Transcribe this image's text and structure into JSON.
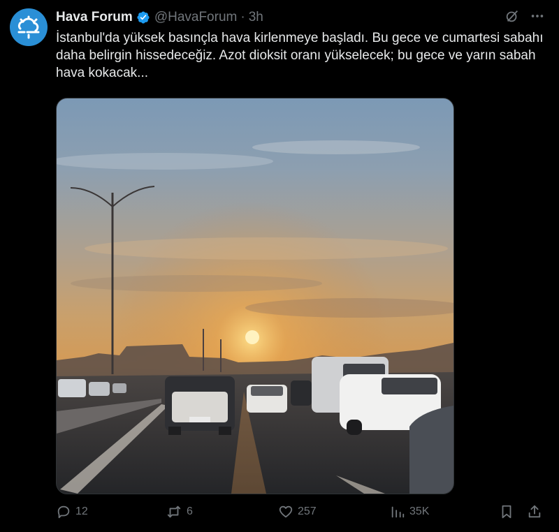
{
  "tweet": {
    "author_name": "Hava Forum",
    "handle": "@HavaForum",
    "separator": "·",
    "time": "3h",
    "text": "İstanbul'da yüksek basınçla hava kirlenmeye başladı. Bu gece ve cumartesi sabahı daha belirgin hissedeceğiz. Azot dioksit oranı yükselecek; bu gece ve yarın sabah hava kokacak...",
    "image_alt": "Photo of highway traffic at sunset under a hazy sky"
  },
  "actions": {
    "replies": "12",
    "reposts": "6",
    "likes": "257",
    "views": "35K"
  },
  "colors": {
    "background": "#000000",
    "text": "#e7e9ea",
    "muted": "#71767b",
    "verified": "#1d9bf0",
    "avatar_bg": "#2a8fd6"
  }
}
